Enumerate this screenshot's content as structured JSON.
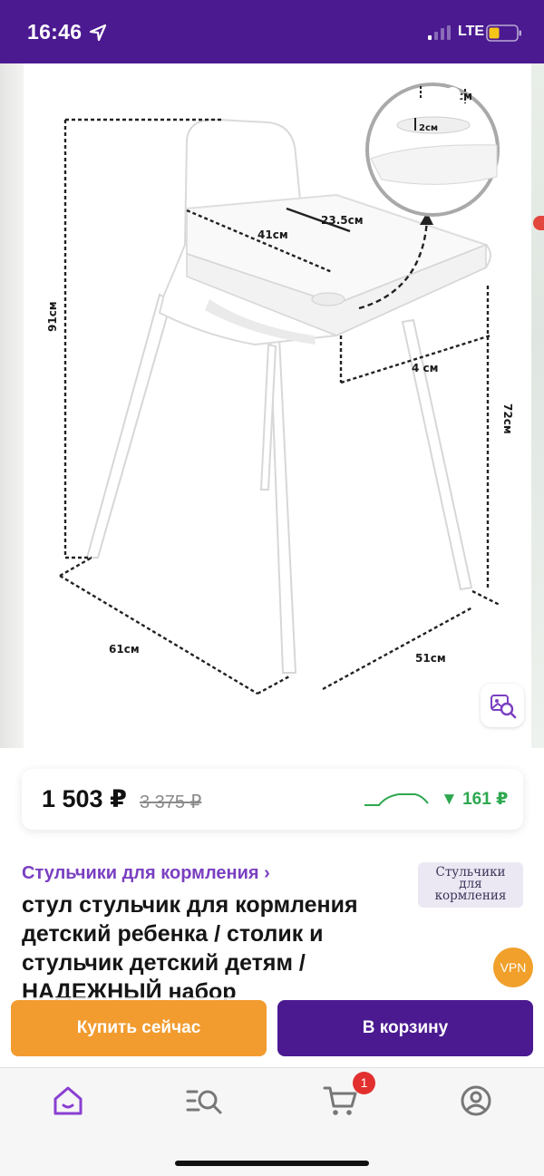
{
  "status_bar": {
    "time": "16:46",
    "network": "LTE",
    "icons": [
      "location-arrow-icon",
      "signal-icon",
      "battery-icon"
    ]
  },
  "gallery": {
    "icons": [
      "chevron-left-icon",
      "heart-icon",
      "share-icon",
      "image-search-icon"
    ],
    "image_labels": {
      "height_total": "91см",
      "seat_width": "41см",
      "tray_depth": "23.5см",
      "cup_height": "2см",
      "cup_width": "см",
      "tray_width": "4 см",
      "seat_height": "72см",
      "base_width": "61см",
      "base_depth": "51см"
    }
  },
  "price": {
    "current": "1 503 ₽",
    "old": "3 375 ₽",
    "drop": "▼ 161 ₽",
    "drop_color": "#2ea84f"
  },
  "product": {
    "category": "Стульчики для кормления ›",
    "category_badge": "Стульчики\nдля\nкормления",
    "title": "стул стульчик для кормления детский ребенка / столик и стульчик детский детям / НАДЕЖНЫЙ набор"
  },
  "vpn_label": "VPN",
  "actions": {
    "buy_now": "Купить сейчас",
    "add_to_cart": "В корзину"
  },
  "bottom_nav": {
    "items": [
      "home-icon",
      "catalog-search-icon",
      "cart-icon",
      "profile-icon"
    ],
    "cart_count": "1"
  },
  "colors": {
    "brand_purple": "#4b1a91",
    "accent_orange": "#f29b2f",
    "link_purple": "#7a3fc1",
    "badge_red": "#e2302e"
  }
}
